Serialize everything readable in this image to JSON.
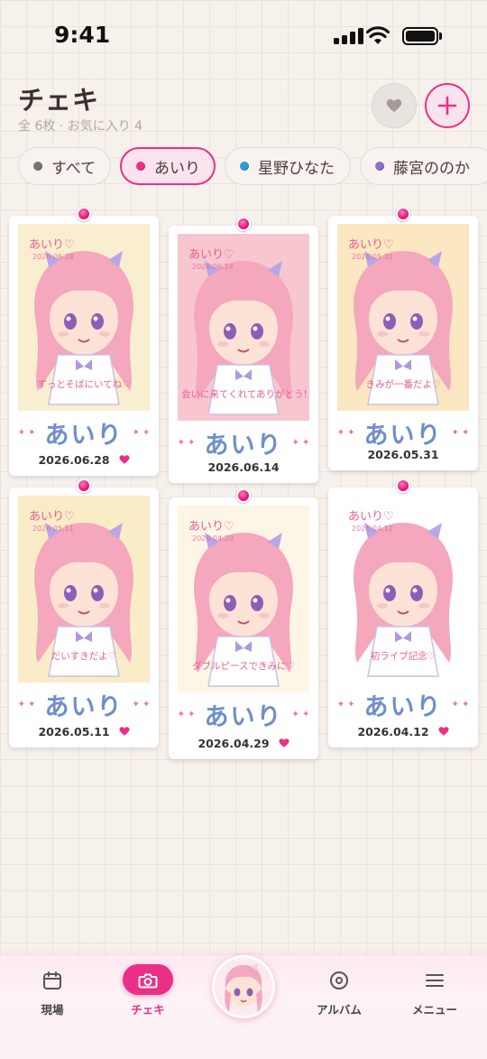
{
  "status_bar": {
    "time": "9:41"
  },
  "header": {
    "title": "チェキ",
    "subtitle": "全 6枚 · お気に入り 4"
  },
  "filters": [
    {
      "label": "すべて",
      "color": "#7a7372",
      "active": false
    },
    {
      "label": "あいり",
      "color": "#ec2f86",
      "active": true
    },
    {
      "label": "星野ひなた",
      "color": "#2b9fd6",
      "active": false
    },
    {
      "label": "藤宮ののか",
      "color": "#8b6fce",
      "active": false
    }
  ],
  "cheki": [
    {
      "photo_title": "あいり♡",
      "photo_date": "2026.06.28",
      "message": "ずっとそばにいてね♡",
      "signature": "あいり",
      "date": "2026.06.28",
      "favorite": true,
      "bg": "#f9eed0"
    },
    {
      "photo_title": "あいり♡",
      "photo_date": "2026.06.14",
      "message": "会いに来てくれてありがとう!",
      "signature": "あいり",
      "date": "2026.06.14",
      "favorite": false,
      "bg": "#f8c6cf"
    },
    {
      "photo_title": "あいり♡",
      "photo_date": "2026.05.31",
      "message": "きみが一番だよ♡",
      "signature": "あいり",
      "date": "2026.05.31",
      "favorite": false,
      "bg": "#fbe7c2"
    },
    {
      "photo_title": "あいり♡",
      "photo_date": "2026.05.11",
      "message": "だいすきだよ♡",
      "signature": "あいり",
      "date": "2026.05.11",
      "favorite": true,
      "bg": "#fbecc8"
    },
    {
      "photo_title": "あいり♡",
      "photo_date": "2026.04.29",
      "message": "ダブルピースできみに♡",
      "signature": "あいり",
      "date": "2026.04.29",
      "favorite": true,
      "bg": "#fdf6e6"
    },
    {
      "photo_title": "あいり♡",
      "photo_date": "2026.04.12",
      "message": "初ライブ記念♡",
      "signature": "あいり",
      "date": "2026.04.12",
      "favorite": true,
      "bg": "#ffffff"
    }
  ],
  "nav": {
    "items": [
      {
        "label": "現場",
        "icon": "calendar-icon"
      },
      {
        "label": "チェキ",
        "icon": "camera-icon",
        "active": true
      },
      {
        "label": "アルバム",
        "icon": "disc-icon"
      },
      {
        "label": "メニュー",
        "icon": "menu-icon"
      }
    ]
  },
  "colors": {
    "accent": "#ec2f86",
    "signature": "#6e8fc9",
    "background": "#f7f1ec"
  }
}
